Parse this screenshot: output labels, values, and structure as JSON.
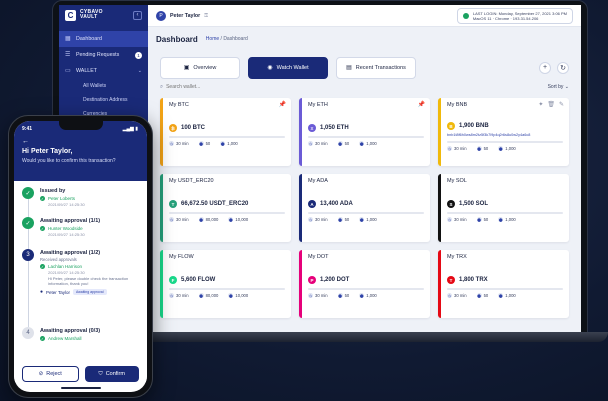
{
  "brand": {
    "logo": "C",
    "name_line1": "CYBAVO",
    "name_line2": "VAULT"
  },
  "sidebar": {
    "items": [
      {
        "label": "Dashboard",
        "icon": "grid-icon",
        "active": true
      },
      {
        "label": "Pending Requests",
        "icon": "list-icon",
        "badge": "1"
      },
      {
        "label": "WALLET",
        "icon": "wallet-icon",
        "chevron": "⌄"
      }
    ],
    "sub_items": [
      "All Wallets",
      "Destination Address",
      "Currencies"
    ]
  },
  "topbar": {
    "avatar": "P",
    "user": "Peter Taylor",
    "status_line1": "LAST LOGIN: Monday, September 27, 2021 3:06 PM",
    "status_line2": "MacOS 11 · Chrome · 193.31.54.206"
  },
  "page": {
    "title": "Dashboard",
    "crumb_home": "Home",
    "crumb_sep": "/",
    "crumb_current": "Dashboard"
  },
  "tabs": [
    {
      "label": "Overview",
      "active": false
    },
    {
      "label": "Watch Wallet",
      "active": true
    },
    {
      "label": "Recent Transactions",
      "active": false
    }
  ],
  "search": {
    "placeholder": "Search wallet...",
    "sort_label": "Sort by ⌄"
  },
  "cards": [
    {
      "name": "My BTC",
      "balance": "100 BTC",
      "coin": "₿",
      "color": "#f2a316",
      "pinned": true,
      "s1": "30 min",
      "s2": "50",
      "s3": "1,000"
    },
    {
      "name": "My ETH",
      "balance": "1,050 ETH",
      "coin": "Ξ",
      "color": "#6b5bd6",
      "pinned": true,
      "s1": "30 min",
      "s2": "50",
      "s3": "1,000"
    },
    {
      "name": "My BNB",
      "balance": "1,900 BNB",
      "coin": "B",
      "color": "#f0b90b",
      "pinned": true,
      "addr": "bnb1t8f6h0ws8m2tz5f3k7l9p4q2r6s8u0w2y4a6c8",
      "s1": "30 min",
      "s2": "50",
      "s3": "1,000"
    },
    {
      "name": "My USDT_ERC20",
      "balance": "66,672.50 USDT_ERC20",
      "coin": "T",
      "color": "#26a17b",
      "s1": "30 min",
      "s2": "80,000",
      "s3": "10,000"
    },
    {
      "name": "My ADA",
      "balance": "13,400 ADA",
      "coin": "A",
      "color": "#1a2a78",
      "s1": "30 min",
      "s2": "50",
      "s3": "1,000"
    },
    {
      "name": "My SOL",
      "balance": "1,500 SOL",
      "coin": "S",
      "color": "#111111",
      "s1": "30 min",
      "s2": "50",
      "s3": "1,000"
    },
    {
      "name": "My FLOW",
      "balance": "5,600 FLOW",
      "coin": "F",
      "color": "#19d98b",
      "s1": "30 min",
      "s2": "80,000",
      "s3": "10,000"
    },
    {
      "name": "My DOT",
      "balance": "1,200 DOT",
      "coin": "P",
      "color": "#e6007a",
      "s1": "30 min",
      "s2": "50",
      "s3": "1,000"
    },
    {
      "name": "My TRX",
      "balance": "1,800 TRX",
      "coin": "T",
      "color": "#e50915",
      "s1": "30 min",
      "s2": "50",
      "s3": "1,000"
    }
  ],
  "phone": {
    "time": "9:41",
    "signal": "▂▄▆ ▮",
    "greeting": "Hi Peter Taylor,",
    "question": "Would you like to confirm this transaction?",
    "steps": [
      {
        "title": "Issued by",
        "approver": "Peter Loberts",
        "ts": "2021/09/27 14:25:30"
      },
      {
        "title": "Awaiting approval (1/1)",
        "approver": "Hunter Woodside",
        "ts": "2021/09/27 14:25:30"
      },
      {
        "number": "3",
        "title": "Awaiting approval (1/2)",
        "sub": "Received approvals",
        "approver": "Lachlan Harrison",
        "ts": "2021/09/27 14:25:30",
        "note": "Hi Peter, please double check the transaction information, thank you!",
        "me": "Peter Taylor",
        "me_badge": "Awaiting approval"
      },
      {
        "number": "4",
        "title": "Awaiting approval (0/3)",
        "approver": "Andrew Marshall"
      }
    ],
    "reject": "Reject",
    "confirm": "Confirm"
  }
}
